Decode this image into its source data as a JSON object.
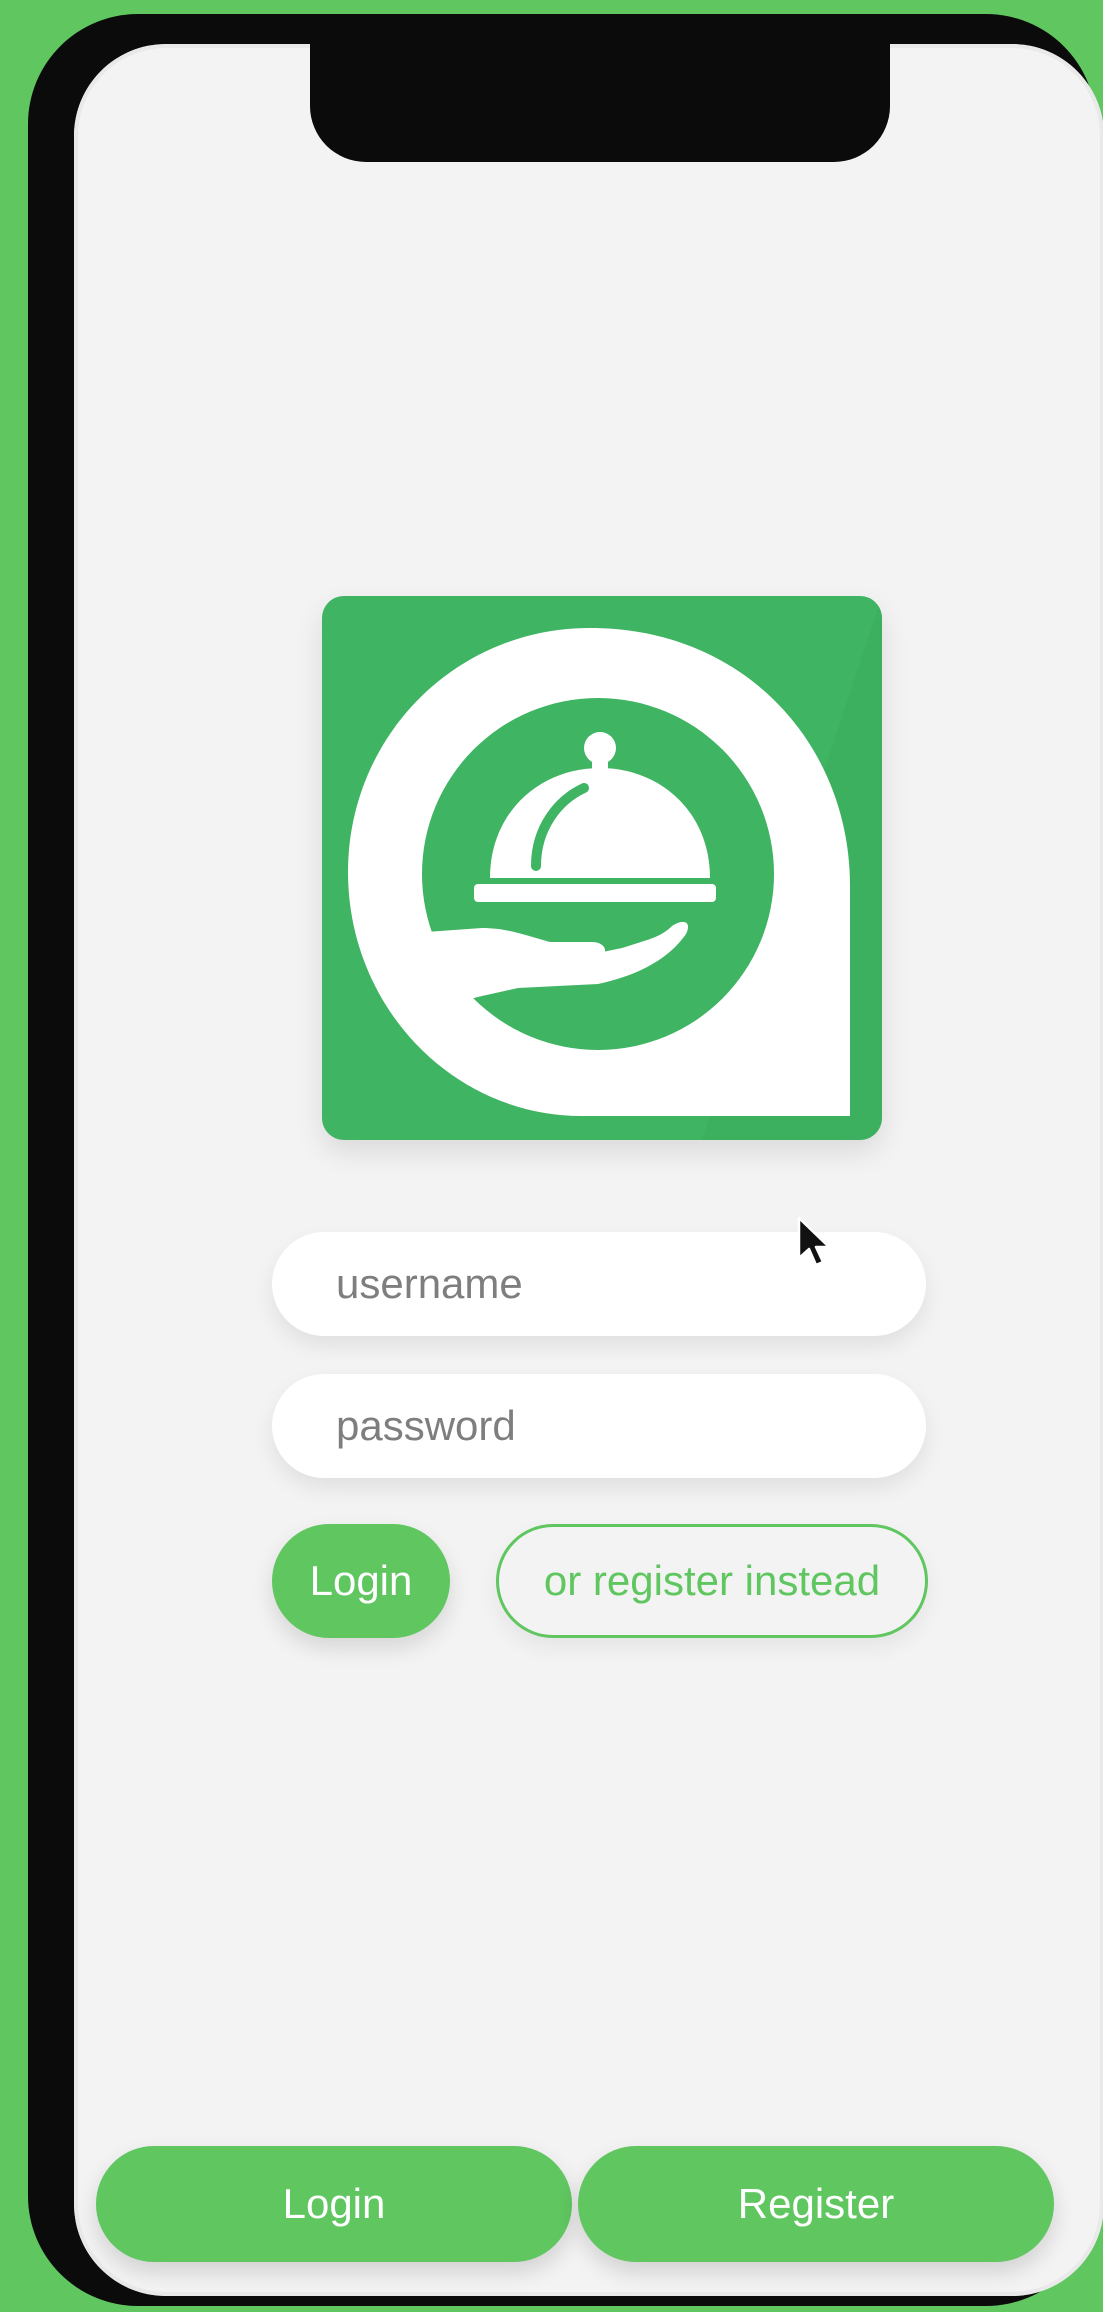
{
  "theme": {
    "accent": "#5fc660",
    "logo_background": "#3fb463",
    "screen_background": "#f3f3f3",
    "frame": "#0b0b0b"
  },
  "logo": {
    "icon": "cloche-serving-hand-icon"
  },
  "form": {
    "username_placeholder": "username",
    "password_placeholder": "password",
    "login_label": "Login",
    "register_instead_label": "or register instead"
  },
  "bottom_tabs": {
    "login_label": "Login",
    "register_label": "Register"
  },
  "pointer": {
    "icon": "mouse-pointer-icon"
  }
}
